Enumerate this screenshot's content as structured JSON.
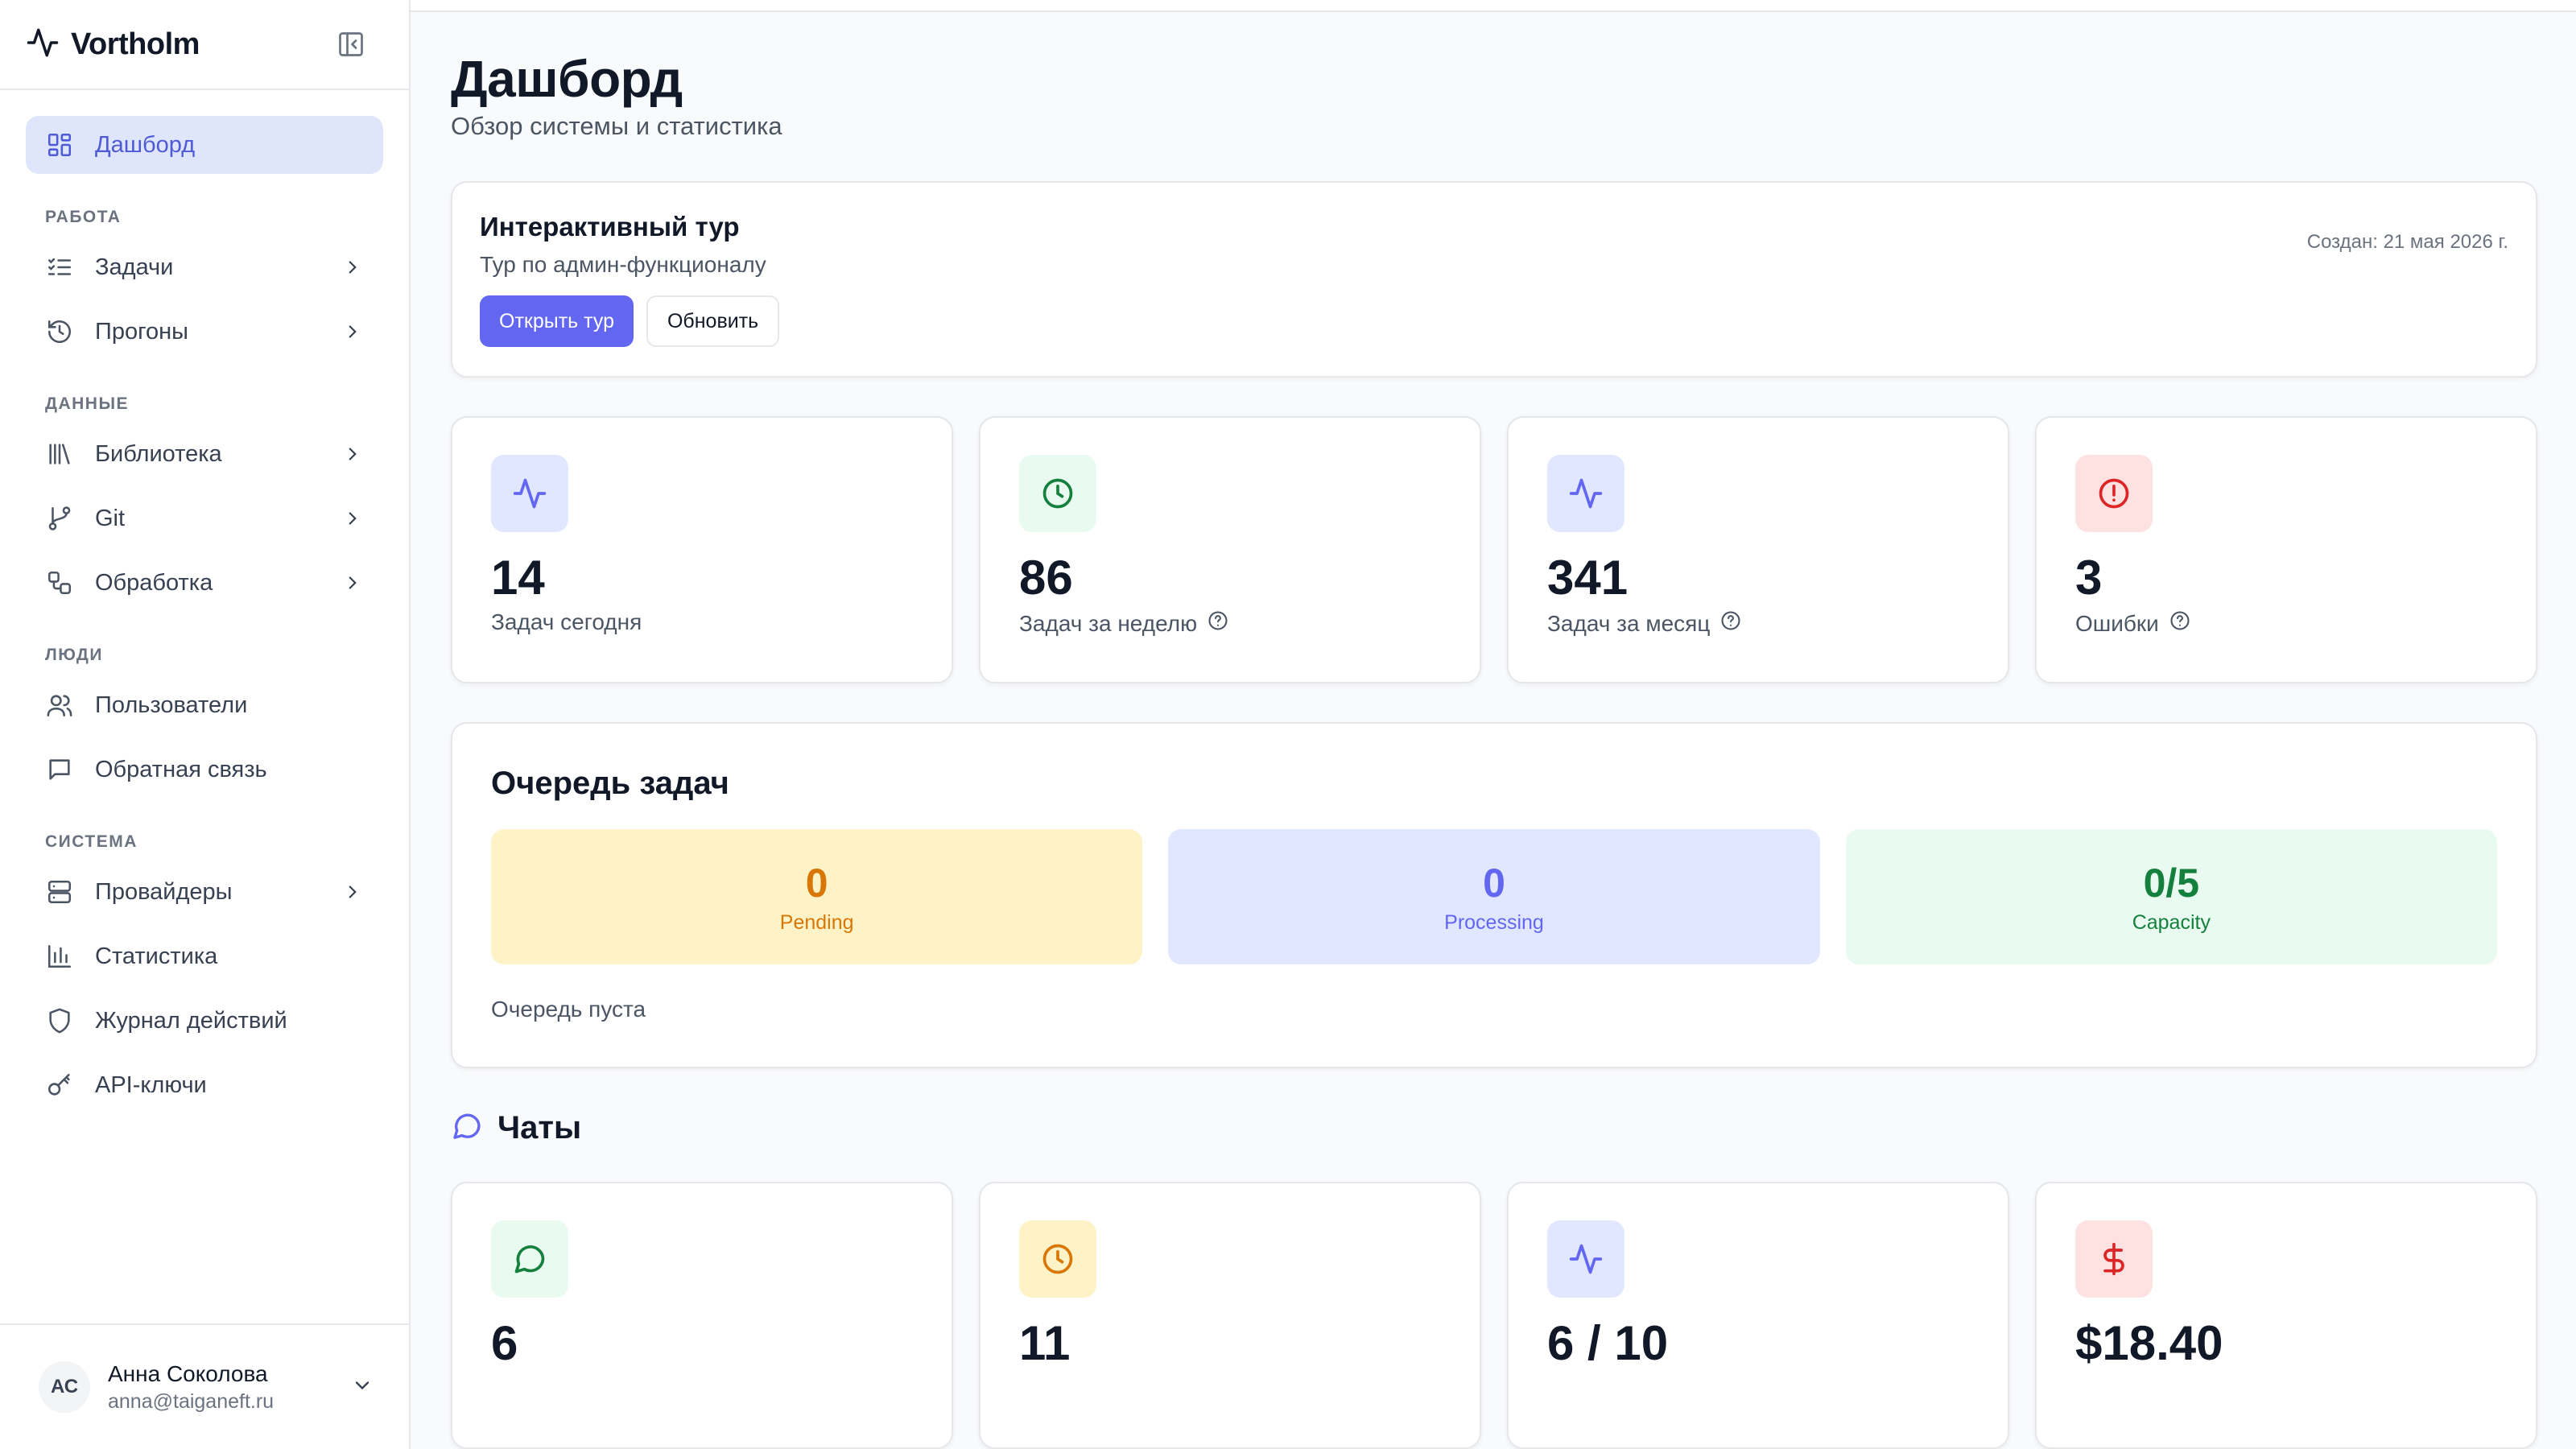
{
  "sidebar": {
    "brand": "Vortholm",
    "active_item": "Дашборд",
    "sections": {
      "work": "РАБОТА",
      "data": "ДАННЫЕ",
      "people": "ЛЮДИ",
      "system": "СИСТЕМА"
    },
    "items": {
      "dashboard": "Дашборд",
      "tasks": "Задачи",
      "runs": "Прогоны",
      "library": "Библиотека",
      "git": "Git",
      "processing": "Обработка",
      "users": "Пользователи",
      "feedback": "Обратная связь",
      "providers": "Провайдеры",
      "statistics": "Статистика",
      "audit_log": "Журнал действий",
      "api_keys": "API-ключи"
    },
    "user": {
      "initials": "АС",
      "name": "Анна Соколова",
      "email": "anna@taiganeft.ru"
    }
  },
  "page": {
    "title": "Дашборд",
    "subtitle": "Обзор системы и статистика"
  },
  "tour": {
    "title": "Интерактивный тур",
    "subtitle": "Тур по админ-функционалу",
    "open_label": "Открыть тур",
    "refresh_label": "Обновить",
    "created": "Создан: 21 мая 2026 г."
  },
  "stats": [
    {
      "value": "14",
      "label": "Задач сегодня"
    },
    {
      "value": "86",
      "label": "Задач за неделю"
    },
    {
      "value": "341",
      "label": "Задач за месяц"
    },
    {
      "value": "3",
      "label": "Ошибки"
    }
  ],
  "queue": {
    "title": "Очередь задач",
    "pending": {
      "value": "0",
      "label": "Pending"
    },
    "processing": {
      "value": "0",
      "label": "Processing"
    },
    "capacity": {
      "value": "0/5",
      "label": "Capacity"
    },
    "empty_text": "Очередь пуста"
  },
  "chats": {
    "title": "Чаты",
    "stats": [
      {
        "value": "6"
      },
      {
        "value": "11"
      },
      {
        "value": "6 / 10"
      },
      {
        "value": "$18.40"
      }
    ]
  },
  "colors": {
    "accent": "#6366f1",
    "active_bg": "#dfe5fb",
    "pending_bg": "#fef3c7",
    "pending_fg": "#d97706",
    "processing_bg": "#e0e7ff",
    "processing_fg": "#6366f1",
    "capacity_bg": "#e9fbf1",
    "capacity_fg": "#15803d",
    "error_fg": "#dc2626"
  }
}
